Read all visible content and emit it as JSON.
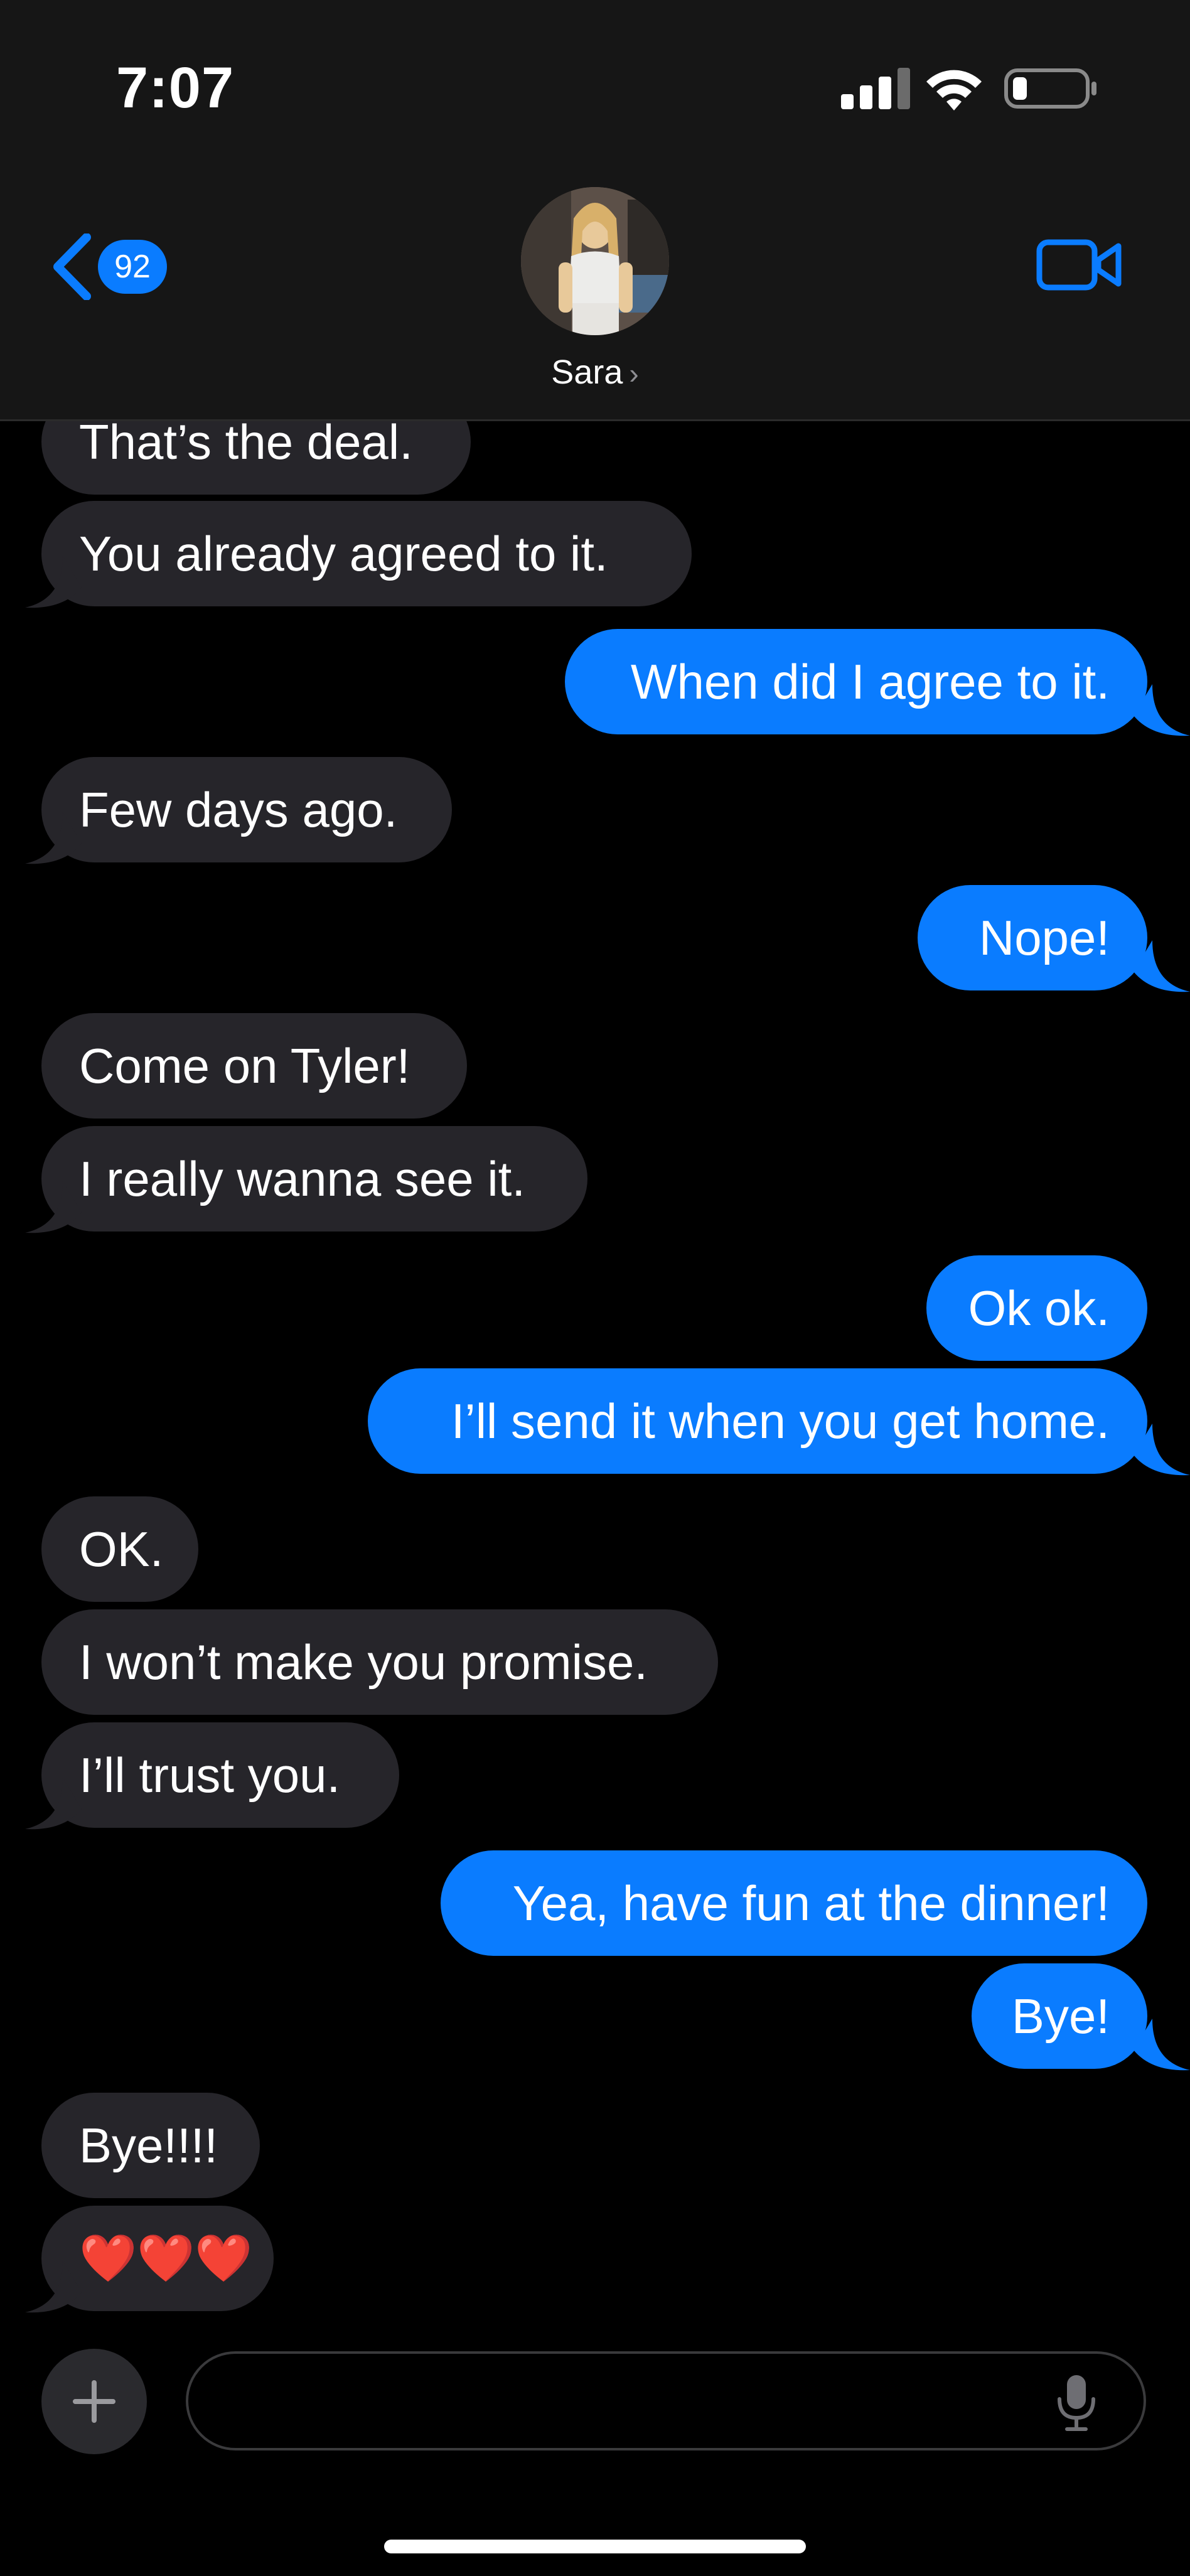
{
  "status_bar": {
    "time": "7:07",
    "icons": [
      "cellular-signal-icon",
      "wifi-icon",
      "battery-icon"
    ]
  },
  "header": {
    "back_count": "92",
    "contact_name": "Sara",
    "icons": [
      "chevron-left-icon",
      "video-camera-icon",
      "chevron-right-icon"
    ]
  },
  "messages": [
    {
      "side": "in",
      "text": "That’s the deal."
    },
    {
      "side": "in",
      "text": "You already agreed to it."
    },
    {
      "side": "out",
      "text": "When did I agree to it."
    },
    {
      "side": "in",
      "text": "Few days ago."
    },
    {
      "side": "out",
      "text": "Nope!"
    },
    {
      "side": "in",
      "text": "Come on Tyler!"
    },
    {
      "side": "in",
      "text": "I really wanna see it."
    },
    {
      "side": "out",
      "text": "Ok ok."
    },
    {
      "side": "out",
      "text": "I’ll send it when you get home."
    },
    {
      "side": "in",
      "text": "OK."
    },
    {
      "side": "in",
      "text": "I won’t make you promise."
    },
    {
      "side": "in",
      "text": "I’ll trust you."
    },
    {
      "side": "out",
      "text": "Yea, have fun at the dinner!"
    },
    {
      "side": "out",
      "text": "Bye!"
    },
    {
      "side": "in",
      "text": "Bye!!!!"
    },
    {
      "side": "in",
      "text": "❤️❤️❤️"
    }
  ],
  "composer": {
    "placeholder": "",
    "icons": [
      "plus-icon",
      "microphone-icon"
    ]
  },
  "colors": {
    "outgoing_bubble": "#0a7cff",
    "incoming_bubble": "#26252a",
    "background": "#000000",
    "header_background": "#161616"
  }
}
